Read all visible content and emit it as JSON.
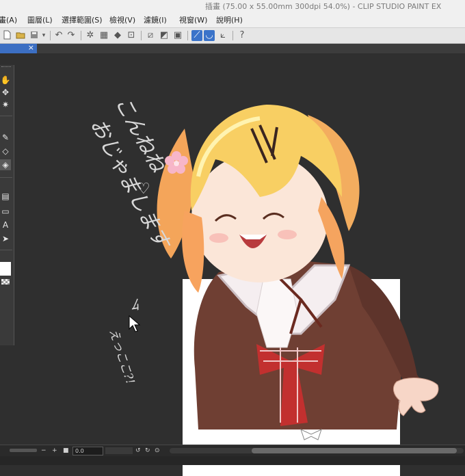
{
  "window": {
    "title": "插畫 (75.00 x 55.00mm 300dpi 54.0%) - CLIP STUDIO PAINT EX"
  },
  "menubar": {
    "items": [
      "畫(A)",
      "圖層(L)",
      "選擇範圍(S)",
      "檢視(V)",
      "濾鏡(I)",
      "視窗(W)",
      "說明(H)"
    ]
  },
  "command_bar": {
    "icons": [
      "new-file-icon",
      "open-folder-icon",
      "save-icon",
      "undo-icon",
      "redo-icon",
      "erase-selection-icon",
      "fill-icon",
      "transform-icon",
      "crop-icon",
      "show-selection-icon",
      "ruler-snap-icon",
      "special-ruler-snap-icon",
      "grid-snap-icon",
      "help-icon"
    ]
  },
  "document_tab": {
    "close_glyph": "×"
  },
  "tool_panel": {
    "tools": [
      "hand-icon",
      "move-icon",
      "auto-select-icon",
      "pen-icon",
      "eraser-icon",
      "fill-bucket-icon",
      "gradient-icon",
      "figure-icon",
      "text-icon",
      "operation-icon"
    ],
    "active_tool": "fill-bucket-icon"
  },
  "canvas": {
    "handwriting": {
      "line1": "こんねね",
      "line2": "おじゃまします",
      "heart": "♡",
      "small_mark": "ﾑ",
      "whisper": "えっここ?!"
    }
  },
  "statusbar": {
    "zoom_value": "0.0",
    "buttons": [
      "−",
      "+",
      "■"
    ]
  },
  "colors": {
    "accent": "#3a73c9",
    "canvas_bg": "#2f2f2f",
    "paper": "#ffffff"
  }
}
